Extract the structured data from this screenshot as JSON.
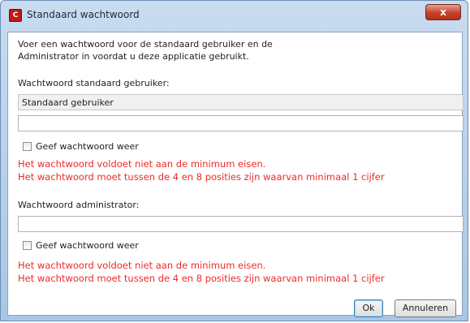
{
  "window": {
    "title": "Standaard wachtwoord",
    "close_label": "x"
  },
  "intro": {
    "line1": "Voer een wachtwoord voor de standaard gebruiker en de",
    "line2": "Administrator in voordat u deze applicatie gebruikt."
  },
  "standard_user": {
    "label": "Wachtwoord standaard gebruiker:",
    "username_value": "Standaard gebruiker",
    "password_value": "",
    "show_password_label": "Geef wachtwoord weer",
    "show_password_checked": false,
    "error_line1": "Het wachtwoord voldoet niet aan de minimum eisen.",
    "error_line2": "Het wachtwoord moet tussen de 4 en 8 posities zijn waarvan minimaal 1 cijfer"
  },
  "administrator": {
    "label": "Wachtwoord administrator:",
    "password_value": "",
    "show_password_label": "Geef wachtwoord weer",
    "show_password_checked": false,
    "error_line1": "Het wachtwoord voldoet niet aan de minimum eisen.",
    "error_line2": "Het wachtwoord moet tussen de 4 en 8 posities zijn waarvan minimaal 1 cijfer"
  },
  "buttons": {
    "ok": "Ok",
    "cancel": "Annuleren"
  },
  "icons": {
    "app": "app-logo-icon",
    "close": "close-icon"
  },
  "colors": {
    "error": "#ee2a2a",
    "close_button": "#c6412a",
    "title_bar": "#c9dcf0"
  }
}
